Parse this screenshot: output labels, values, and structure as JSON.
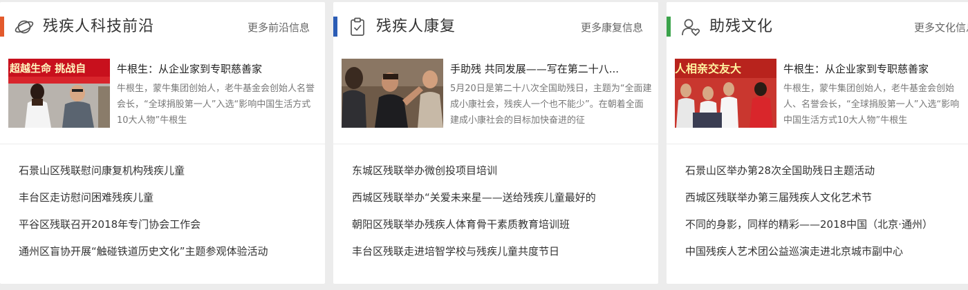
{
  "panels": [
    {
      "title": "残疾人科技前沿",
      "more": "更多前沿信息",
      "accent_color": "#e35a2c",
      "icon": "planet-icon",
      "feature": {
        "title": "牛根生：从企业家到专职慈善家",
        "desc": "牛根生，蒙牛集团创始人，老牛基金会创始人名誉会长，“全球捐股第一人”入选“影响中国生活方式10大人物”牛根生",
        "image_caption": "超越生命 挑战自"
      },
      "list": [
        "石景山区残联慰问康复机构残疾儿童",
        "丰台区走访慰问困难残疾儿童",
        "平谷区残联召开2018年专门协会工作会",
        "通州区盲协开展“触碰铁道历史文化”主题参观体验活动"
      ]
    },
    {
      "title": "残疾人康复",
      "more": "更多康复信息",
      "accent_color": "#2b5cb5",
      "icon": "clipboard-check-icon",
      "feature": {
        "title": "手助残 共同发展——写在第二十八...",
        "desc": "5月20日是第二十八次全国助残日，主题为“全面建成小康社会，残疾人一个也不能少”。在朝着全面建成小康社会的目标加快奋进的征",
        "image_caption": ""
      },
      "list": [
        "东城区残联举办微创投项目培训",
        "西城区残联举办“关爱未来星——送给残疾儿童最好的",
        "朝阳区残联举办残疾人体育骨干素质教育培训班",
        "丰台区残联走进培智学校与残疾儿童共度节日"
      ]
    },
    {
      "title": "助残文化",
      "more": "更多文化信息",
      "accent_color": "#3ba34b",
      "icon": "user-heart-icon",
      "feature": {
        "title": "牛根生：从企业家到专职慈善家",
        "desc": "牛根生，蒙牛集团创始人，老牛基金会创始人、名誉会长，“全球捐股第一人”入选“影响中国生活方式10大人物”牛根生",
        "image_caption": "人相亲交友大"
      },
      "list": [
        "石景山区举办第28次全国助残日主题活动",
        "西城区残联举办第三届残疾人文化艺术节",
        "不同的身影，同样的精彩——2018中国（北京·通州）",
        "中国残疾人艺术团公益巡演走进北京城市副中心"
      ]
    }
  ]
}
